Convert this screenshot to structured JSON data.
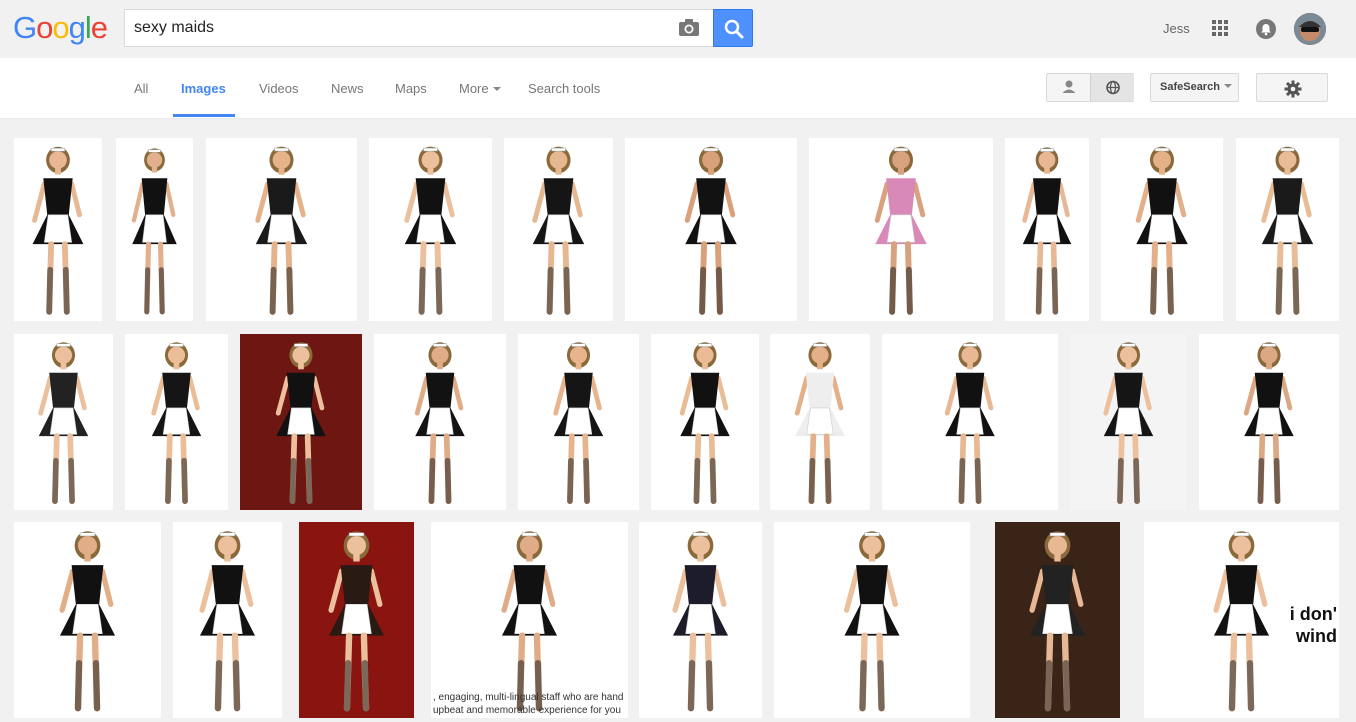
{
  "header": {
    "logo": [
      "G",
      "o",
      "o",
      "g",
      "l",
      "e"
    ],
    "logo_colors": [
      "#4285f4",
      "#ea4335",
      "#fbbc05",
      "#4285f4",
      "#34a853",
      "#ea4335"
    ],
    "search_value": "sexy maids",
    "user_name": "Jess"
  },
  "nav": {
    "tabs": [
      {
        "label": "All"
      },
      {
        "label": "Images"
      },
      {
        "label": "Videos"
      },
      {
        "label": "News"
      },
      {
        "label": "Maps"
      },
      {
        "label": "More"
      },
      {
        "label": "Search tools"
      }
    ],
    "active_tab": "Images",
    "safesearch_label": "SafeSearch"
  },
  "results": {
    "row1": [
      {
        "bg": "#ffffff",
        "outfit": "#111111",
        "skin": "#e8b894"
      },
      {
        "bg": "#ffffff",
        "outfit": "#111111",
        "skin": "#e2b08c"
      },
      {
        "bg": "#ffffff",
        "outfit": "#1a1a1a",
        "skin": "#e6b28a"
      },
      {
        "bg": "#ffffff",
        "outfit": "#111111",
        "skin": "#ecc09c"
      },
      {
        "bg": "#ffffff",
        "outfit": "#151515",
        "skin": "#e6b892"
      },
      {
        "bg": "#ffffff",
        "outfit": "#121212",
        "skin": "#d9a07a"
      },
      {
        "bg": "#ffffff",
        "outfit": "#d889b8",
        "skin": "#d8a27e"
      },
      {
        "bg": "#ffffff",
        "outfit": "#111111",
        "skin": "#e8b894"
      },
      {
        "bg": "#ffffff",
        "outfit": "#111111",
        "skin": "#e4b08a"
      },
      {
        "bg": "#ffffff",
        "outfit": "#1a1a1a",
        "skin": "#e8bc96"
      }
    ],
    "row2": [
      {
        "bg": "#ffffff",
        "outfit": "#222222",
        "skin": "#ecc09c"
      },
      {
        "bg": "#ffffff",
        "outfit": "#151515",
        "skin": "#ecbe98"
      },
      {
        "bg": "#6e1612",
        "outfit": "#111111",
        "skin": "#ecc09c"
      },
      {
        "bg": "#ffffff",
        "outfit": "#121212",
        "skin": "#e0ac88"
      },
      {
        "bg": "#ffffff",
        "outfit": "#151515",
        "skin": "#e8b48e"
      },
      {
        "bg": "#ffffff",
        "outfit": "#111111",
        "skin": "#eabc96"
      },
      {
        "bg": "#ffffff",
        "outfit": "#eeeeee",
        "skin": "#e4b08a"
      },
      {
        "bg": "#ffffff",
        "outfit": "#111111",
        "skin": "#e8b894"
      },
      {
        "bg": "#f4f4f4",
        "outfit": "#151515",
        "skin": "#ecc09c"
      },
      {
        "bg": "#ffffff",
        "outfit": "#111111",
        "skin": "#dca884"
      }
    ],
    "row3": [
      {
        "bg": "#ffffff",
        "outfit": "#111111",
        "skin": "#e2ae88"
      },
      {
        "bg": "#ffffff",
        "outfit": "#111111",
        "skin": "#ecc09c"
      },
      {
        "bg": "#8a1410",
        "outfit": "#2a1a14",
        "skin": "#ecc09c"
      },
      {
        "bg": "#ffffff",
        "outfit": "#111111",
        "skin": "#e0ac88",
        "caption": [
          ", engaging, multi-lingual staff who are hand",
          "upbeat and memorable experience for you"
        ]
      },
      {
        "bg": "#ffffff",
        "outfit": "#1c1c2a",
        "skin": "#ecc09c"
      },
      {
        "bg": "#ffffff",
        "outfit": "#111111",
        "skin": "#ecc09c"
      },
      {
        "bg": "#3a2418",
        "outfit": "#222222",
        "skin": "#e8b894"
      },
      {
        "bg": "#ffffff",
        "outfit": "#111111",
        "skin": "#ecc09c",
        "caption": [
          "i don'",
          "wind"
        ]
      }
    ]
  }
}
